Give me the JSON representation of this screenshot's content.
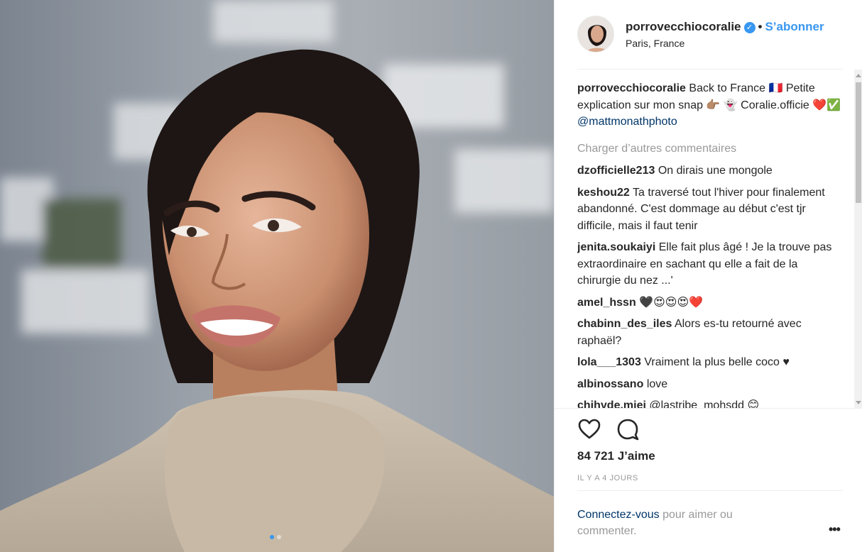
{
  "post": {
    "username": "porrovecchiocoralie",
    "verified_icon": "verified-badge-icon",
    "separator": "•",
    "follow_label": "S’abonner",
    "location": "Paris, France"
  },
  "caption": {
    "username": "porrovecchiocoralie",
    "text_1": "Back to France 🇫🇷 Petite explication sur mon snap 👉🏽 👻 Coralie.officie ❤️✅ ",
    "mention": "@mattmonathphoto"
  },
  "load_more_label": "Charger d’autres commentaires",
  "comments": [
    {
      "user": "dzofficielle213",
      "text": "On dirais une mongole"
    },
    {
      "user": "keshou22",
      "text": "Ta traversé tout l'hiver pour finalement abandonné. C'est dommage au début c'est tjr difficile, mais il faut tenir"
    },
    {
      "user": "jenita.soukaiyi",
      "text": "Elle fait plus âgé ! Je la trouve pas extraordinaire en sachant qu elle a fait de la chirurgie du nez ...'"
    },
    {
      "user": "amel_hssn",
      "text": "🖤😍😍😍❤️"
    },
    {
      "user": "chabinn_des_iles",
      "text": "Alors es-tu retourné avec raphaël?"
    },
    {
      "user": "lola___1303",
      "text": "Vraiment la plus belle coco ♥"
    },
    {
      "user": "albinossano",
      "text": "love"
    },
    {
      "user": "chihyde.mjej",
      "text": "@lastribe_mohsdd 😊"
    }
  ],
  "likes_label": "84 721 J’aime",
  "timestamp": "IL Y A 4 JOURS",
  "login": {
    "link_label": "Connectez-vous",
    "rest": " pour aimer ou commenter."
  },
  "options_label": "•••",
  "colors": {
    "accent": "#3897f0",
    "link": "#003569",
    "muted": "#999999"
  }
}
